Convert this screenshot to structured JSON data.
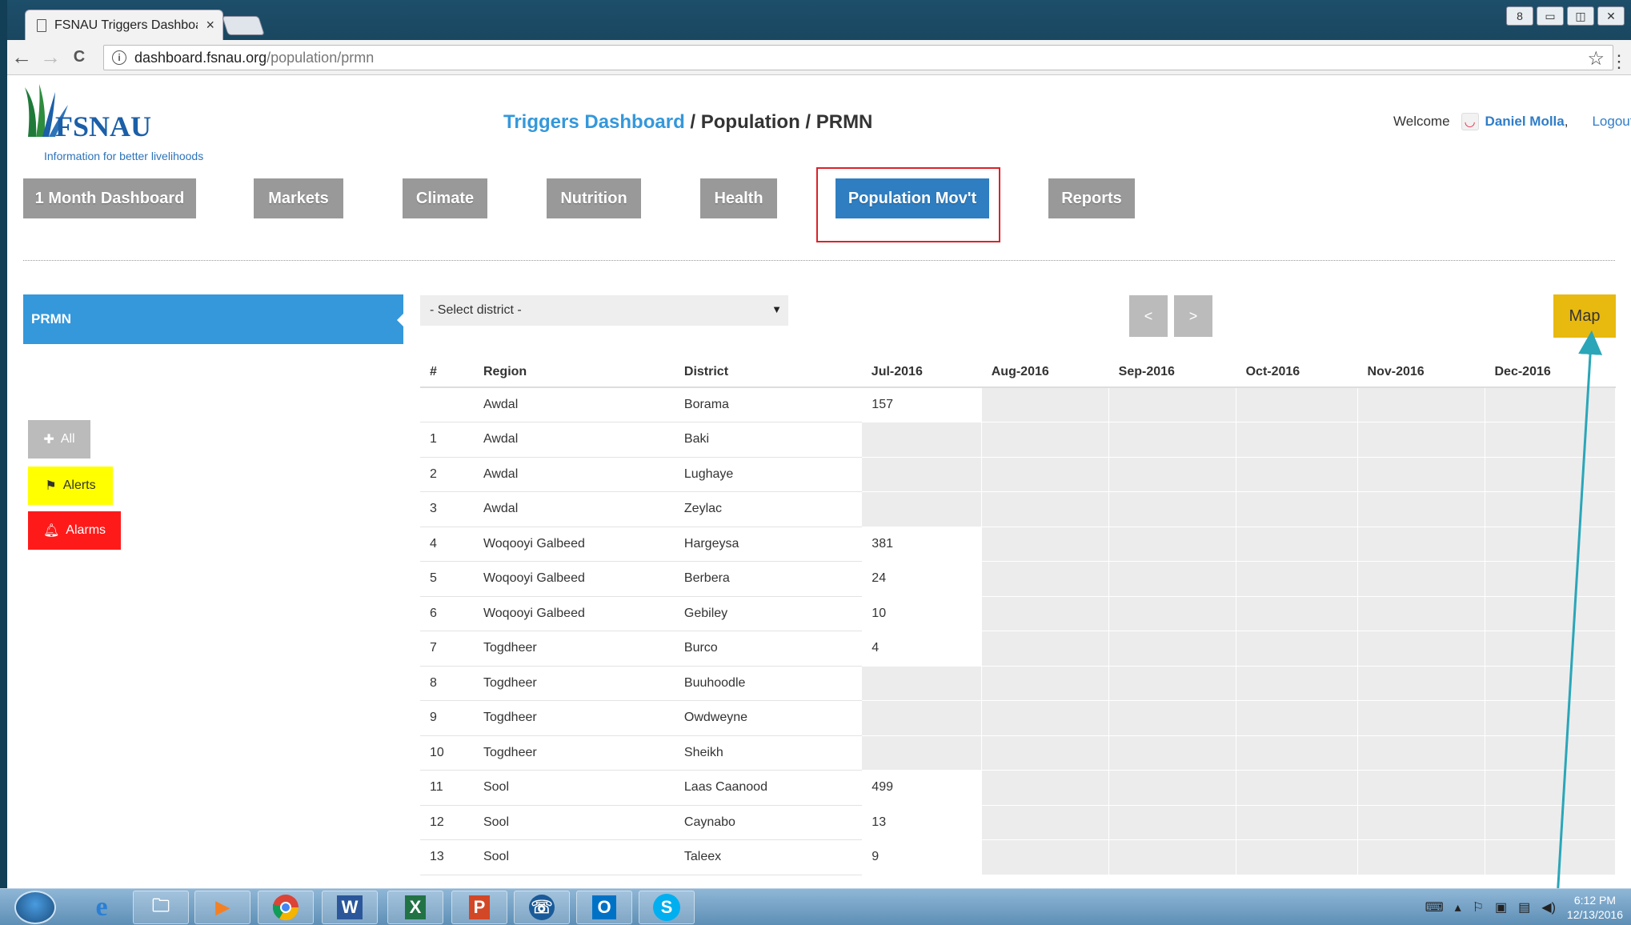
{
  "browser": {
    "tab_title": "FSNAU Triggers Dashboa",
    "tab_close": "×",
    "url_host": "dashboard.fsnau.org",
    "url_path": "/population/prmn",
    "back": "←",
    "forward": "→",
    "reload": "C",
    "star": "☆",
    "menu": "⋮",
    "window_buttons": [
      "8",
      "▭",
      "◫",
      "✕"
    ]
  },
  "header": {
    "logo_text": "FSNAU",
    "tagline": "Information for better livelihoods",
    "crumb_link": "Triggers Dashboard",
    "crumb_rest": " / Population / PRMN",
    "welcome": "Welcome",
    "user": "Daniel Molla",
    "user_sep": ",",
    "logout": "Logout"
  },
  "nav": {
    "items": [
      {
        "label": "1 Month Dashboard",
        "active": false
      },
      {
        "label": "Markets",
        "active": false
      },
      {
        "label": "Climate",
        "active": false
      },
      {
        "label": "Nutrition",
        "active": false
      },
      {
        "label": "Health",
        "active": false
      },
      {
        "label": "Population Mov't",
        "active": true
      },
      {
        "label": "Reports",
        "active": false
      }
    ]
  },
  "sidebar": {
    "panel_title": "PRMN",
    "all_label": "All",
    "alerts_label": "Alerts",
    "alarms_label": "Alarms"
  },
  "controls": {
    "district_placeholder": "- Select district -",
    "prev": "<",
    "next": ">",
    "map": "Map"
  },
  "table": {
    "headers": [
      "#",
      "Region",
      "District",
      "Jul-2016",
      "Aug-2016",
      "Sep-2016",
      "Oct-2016",
      "Nov-2016",
      "Dec-2016"
    ],
    "rows": [
      {
        "num": "",
        "region": "Awdal",
        "district": "Borama",
        "jul": "157"
      },
      {
        "num": "1",
        "region": "Awdal",
        "district": "Baki",
        "jul": ""
      },
      {
        "num": "2",
        "region": "Awdal",
        "district": "Lughaye",
        "jul": ""
      },
      {
        "num": "3",
        "region": "Awdal",
        "district": "Zeylac",
        "jul": ""
      },
      {
        "num": "4",
        "region": "Woqooyi Galbeed",
        "district": "Hargeysa",
        "jul": "381"
      },
      {
        "num": "5",
        "region": "Woqooyi Galbeed",
        "district": "Berbera",
        "jul": "24"
      },
      {
        "num": "6",
        "region": "Woqooyi Galbeed",
        "district": "Gebiley",
        "jul": "10"
      },
      {
        "num": "7",
        "region": "Togdheer",
        "district": "Burco",
        "jul": "4"
      },
      {
        "num": "8",
        "region": "Togdheer",
        "district": "Buuhoodle",
        "jul": ""
      },
      {
        "num": "9",
        "region": "Togdheer",
        "district": "Owdweyne",
        "jul": ""
      },
      {
        "num": "10",
        "region": "Togdheer",
        "district": "Sheikh",
        "jul": ""
      },
      {
        "num": "11",
        "region": "Sool",
        "district": "Laas Caanood",
        "jul": "499"
      },
      {
        "num": "12",
        "region": "Sool",
        "district": "Caynabo",
        "jul": "13"
      },
      {
        "num": "13",
        "region": "Sool",
        "district": "Taleex",
        "jul": "9"
      }
    ]
  },
  "taskbar": {
    "time": "6:12 PM",
    "date": "12/13/2016"
  },
  "colors": {
    "accent_blue": "#3498db",
    "highlight_red": "#d9232a",
    "map_yellow": "#e8b90f",
    "arrow_teal": "#2aa6b8"
  }
}
